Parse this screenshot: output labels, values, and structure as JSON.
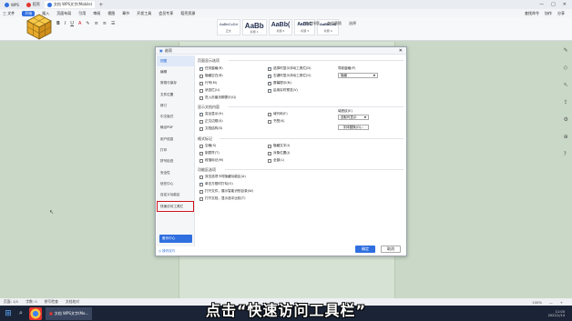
{
  "titlebar": {
    "tabs": [
      {
        "label": "WPS",
        "color": "#2f6fe0"
      },
      {
        "label": "稻壳",
        "color": "#e3342f"
      },
      {
        "label": "文档 WPS文字(Mobile)",
        "color": "#2f6fe0",
        "active": true
      }
    ]
  },
  "menubar": {
    "items": [
      "三 文件",
      "开始",
      "插入",
      "页面布局",
      "引用",
      "审阅",
      "视图",
      "章节",
      "开发工具",
      "会员专享",
      "稻壳资源"
    ],
    "active_index": 1,
    "right": [
      "查找命令",
      "协作",
      "分享"
    ]
  },
  "ribbon": {
    "styles": [
      {
        "big": "AaBbCcDd",
        "label": "正文"
      },
      {
        "big": "AaBb",
        "label": "标题 1"
      },
      {
        "big": "AaBb(",
        "label": "标题 2"
      },
      {
        "big": "AaBbC",
        "label": "标题 3"
      },
      {
        "big": "AaBbCcD",
        "label": "标题 4"
      }
    ],
    "right": [
      "文字排版",
      "查找替换",
      "选择"
    ]
  },
  "dialog": {
    "title": "选项",
    "nav": [
      "视图",
      "编辑",
      "常规与保存",
      "文件位置",
      "修订",
      "中文版式",
      "输出PDF",
      "用户信息",
      "打印",
      "拼写检查",
      "安全性",
      "信任中心",
      "自定义功能区",
      "快速访问工具栏"
    ],
    "selected_index": 0,
    "highlight_index": 13,
    "backup_label": "备份中心",
    "help_label": "操作技巧",
    "sections": {
      "page_display": {
        "title": "页面显示选项",
        "items": [
          {
            "label": "任务窗格(R)",
            "checked": true
          },
          {
            "label": "隐藏空白(B)",
            "checked": false
          },
          {
            "label": "行号(M)",
            "checked": false
          },
          {
            "label": "状态栏(U)",
            "checked": false
          },
          {
            "label": "进入页眉页脚提示(Q)",
            "checked": false
          },
          {
            "label": "选择时显示浮动工具栏(D)",
            "checked": true
          },
          {
            "label": "右键时显示浮动工具栏(G)",
            "checked": true
          },
          {
            "label": "屏幕提示(N)",
            "checked": true
          },
          {
            "label": "启用实时预览(V)",
            "checked": true
          }
        ],
        "nav_label": "导航窗格(P)",
        "nav_value": "隐藏"
      },
      "format_marks": {
        "title": "显示文档内容",
        "items": [
          {
            "label": "突出显示(H)",
            "checked": true
          },
          {
            "label": "正文边框(X)",
            "checked": false
          },
          {
            "label": "域代码(F)",
            "checked": false
          },
          {
            "label": "书签(K)",
            "checked": false
          },
          {
            "label": "文档结构(S)",
            "checked": false
          }
        ],
        "shading_label": "域底纹(E)",
        "shading_value": "选取时显示",
        "font_button": "字体替换(O)..."
      },
      "format_marker": {
        "title": "格式标记",
        "items": [
          {
            "label": "空格(S)",
            "checked": false
          },
          {
            "label": "制表符(T)",
            "checked": false
          },
          {
            "label": "段落标记(M)",
            "checked": false
          },
          {
            "label": "隐藏文字(I)",
            "checked": false
          },
          {
            "label": "对象位置(J)",
            "checked": false
          },
          {
            "label": "全部(L)",
            "checked": false
          }
        ]
      },
      "func_warning": {
        "title": "功能区选项",
        "items": [
          {
            "label": "双击选项卡时隐藏功能区(A)",
            "checked": false
          },
          {
            "label": "单击方框时打勾(O)",
            "checked": true
          },
          {
            "label": "打开文件，展示智能识别目录(W)",
            "checked": false
          },
          {
            "label": "打开文档，显示选中比较(T)",
            "checked": false
          }
        ]
      }
    },
    "ok_label": "确定",
    "cancel_label": "取消"
  },
  "statusbar": {
    "left": [
      "页面: 1/1",
      "字数: 0",
      "拼写检查",
      "文档校对"
    ],
    "right": [
      "100%",
      "—",
      "+"
    ]
  },
  "taskbar": {
    "active_app": "文档 WPS文字(Mo...",
    "time": "11:00",
    "date": "2022/1/14"
  },
  "caption": "点击“快速访问工具栏”",
  "colors": {
    "accent": "#2f6fe0",
    "highlight": "#d1151b",
    "doc_bg": "#d6e2d3"
  }
}
